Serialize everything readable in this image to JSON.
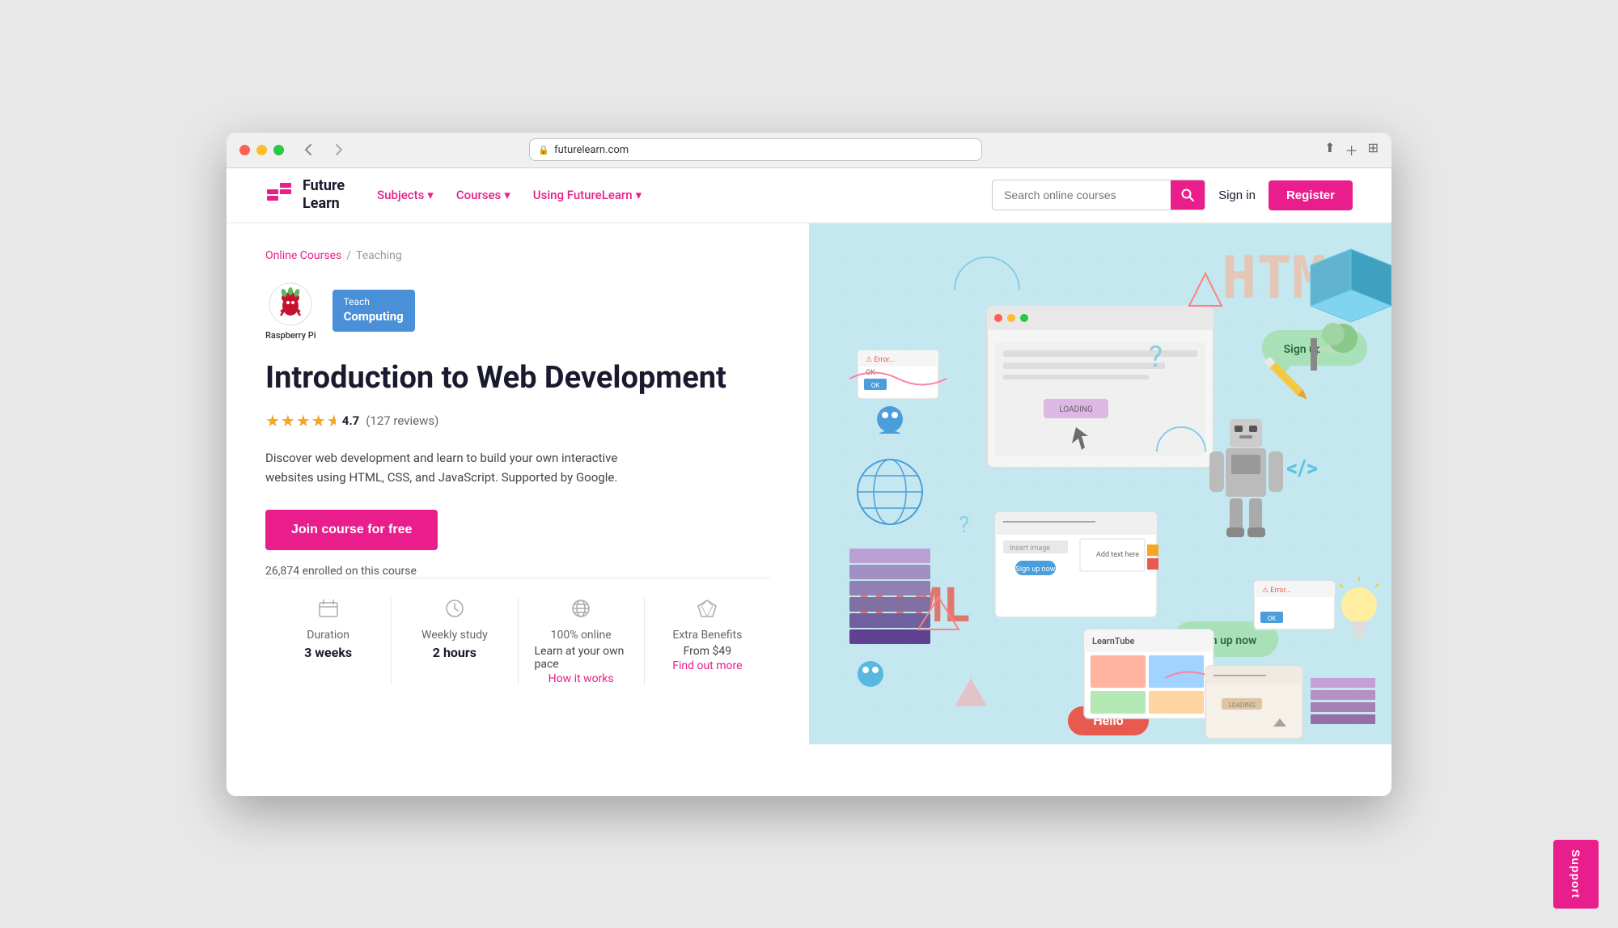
{
  "browser": {
    "url": "futurelearn.com",
    "back_label": "‹",
    "forward_label": "›"
  },
  "nav": {
    "logo_line1": "Future",
    "logo_line2": "Learn",
    "links": [
      {
        "label": "Subjects",
        "hasArrow": true
      },
      {
        "label": "Courses",
        "hasArrow": true
      },
      {
        "label": "Using FutureLearn",
        "hasArrow": true
      }
    ],
    "search_placeholder": "Search online courses",
    "sign_in": "Sign in",
    "register": "Register"
  },
  "breadcrumb": {
    "home": "Online Courses",
    "separator": "/",
    "current": "Teaching"
  },
  "partners": {
    "raspberry_label": "Raspberry Pi",
    "teach_line1": "Teach",
    "teach_line2": "Computing"
  },
  "course": {
    "title": "Introduction to Web Development",
    "rating_stars": "★★★★½",
    "rating_score": "4.7",
    "rating_count": "(127 reviews)",
    "description": "Discover web development and learn to build your own interactive websites using HTML, CSS, and JavaScript. Supported by Google.",
    "cta": "Join course for free",
    "enrolled_text": "26,874 enrolled on this course"
  },
  "stats": [
    {
      "icon": "⏳",
      "label": "Duration",
      "value": "3 weeks"
    },
    {
      "icon": "⏰",
      "label": "Weekly study",
      "value": "2 hours"
    },
    {
      "icon": "🌐",
      "label": "100% online",
      "sub": "Learn at your own pace",
      "link": "How it works",
      "value": ""
    },
    {
      "icon": "💎",
      "label": "Extra Benefits",
      "sub": "From $49",
      "link": "Find out more",
      "value": ""
    }
  ],
  "support": {
    "label": "Support"
  }
}
